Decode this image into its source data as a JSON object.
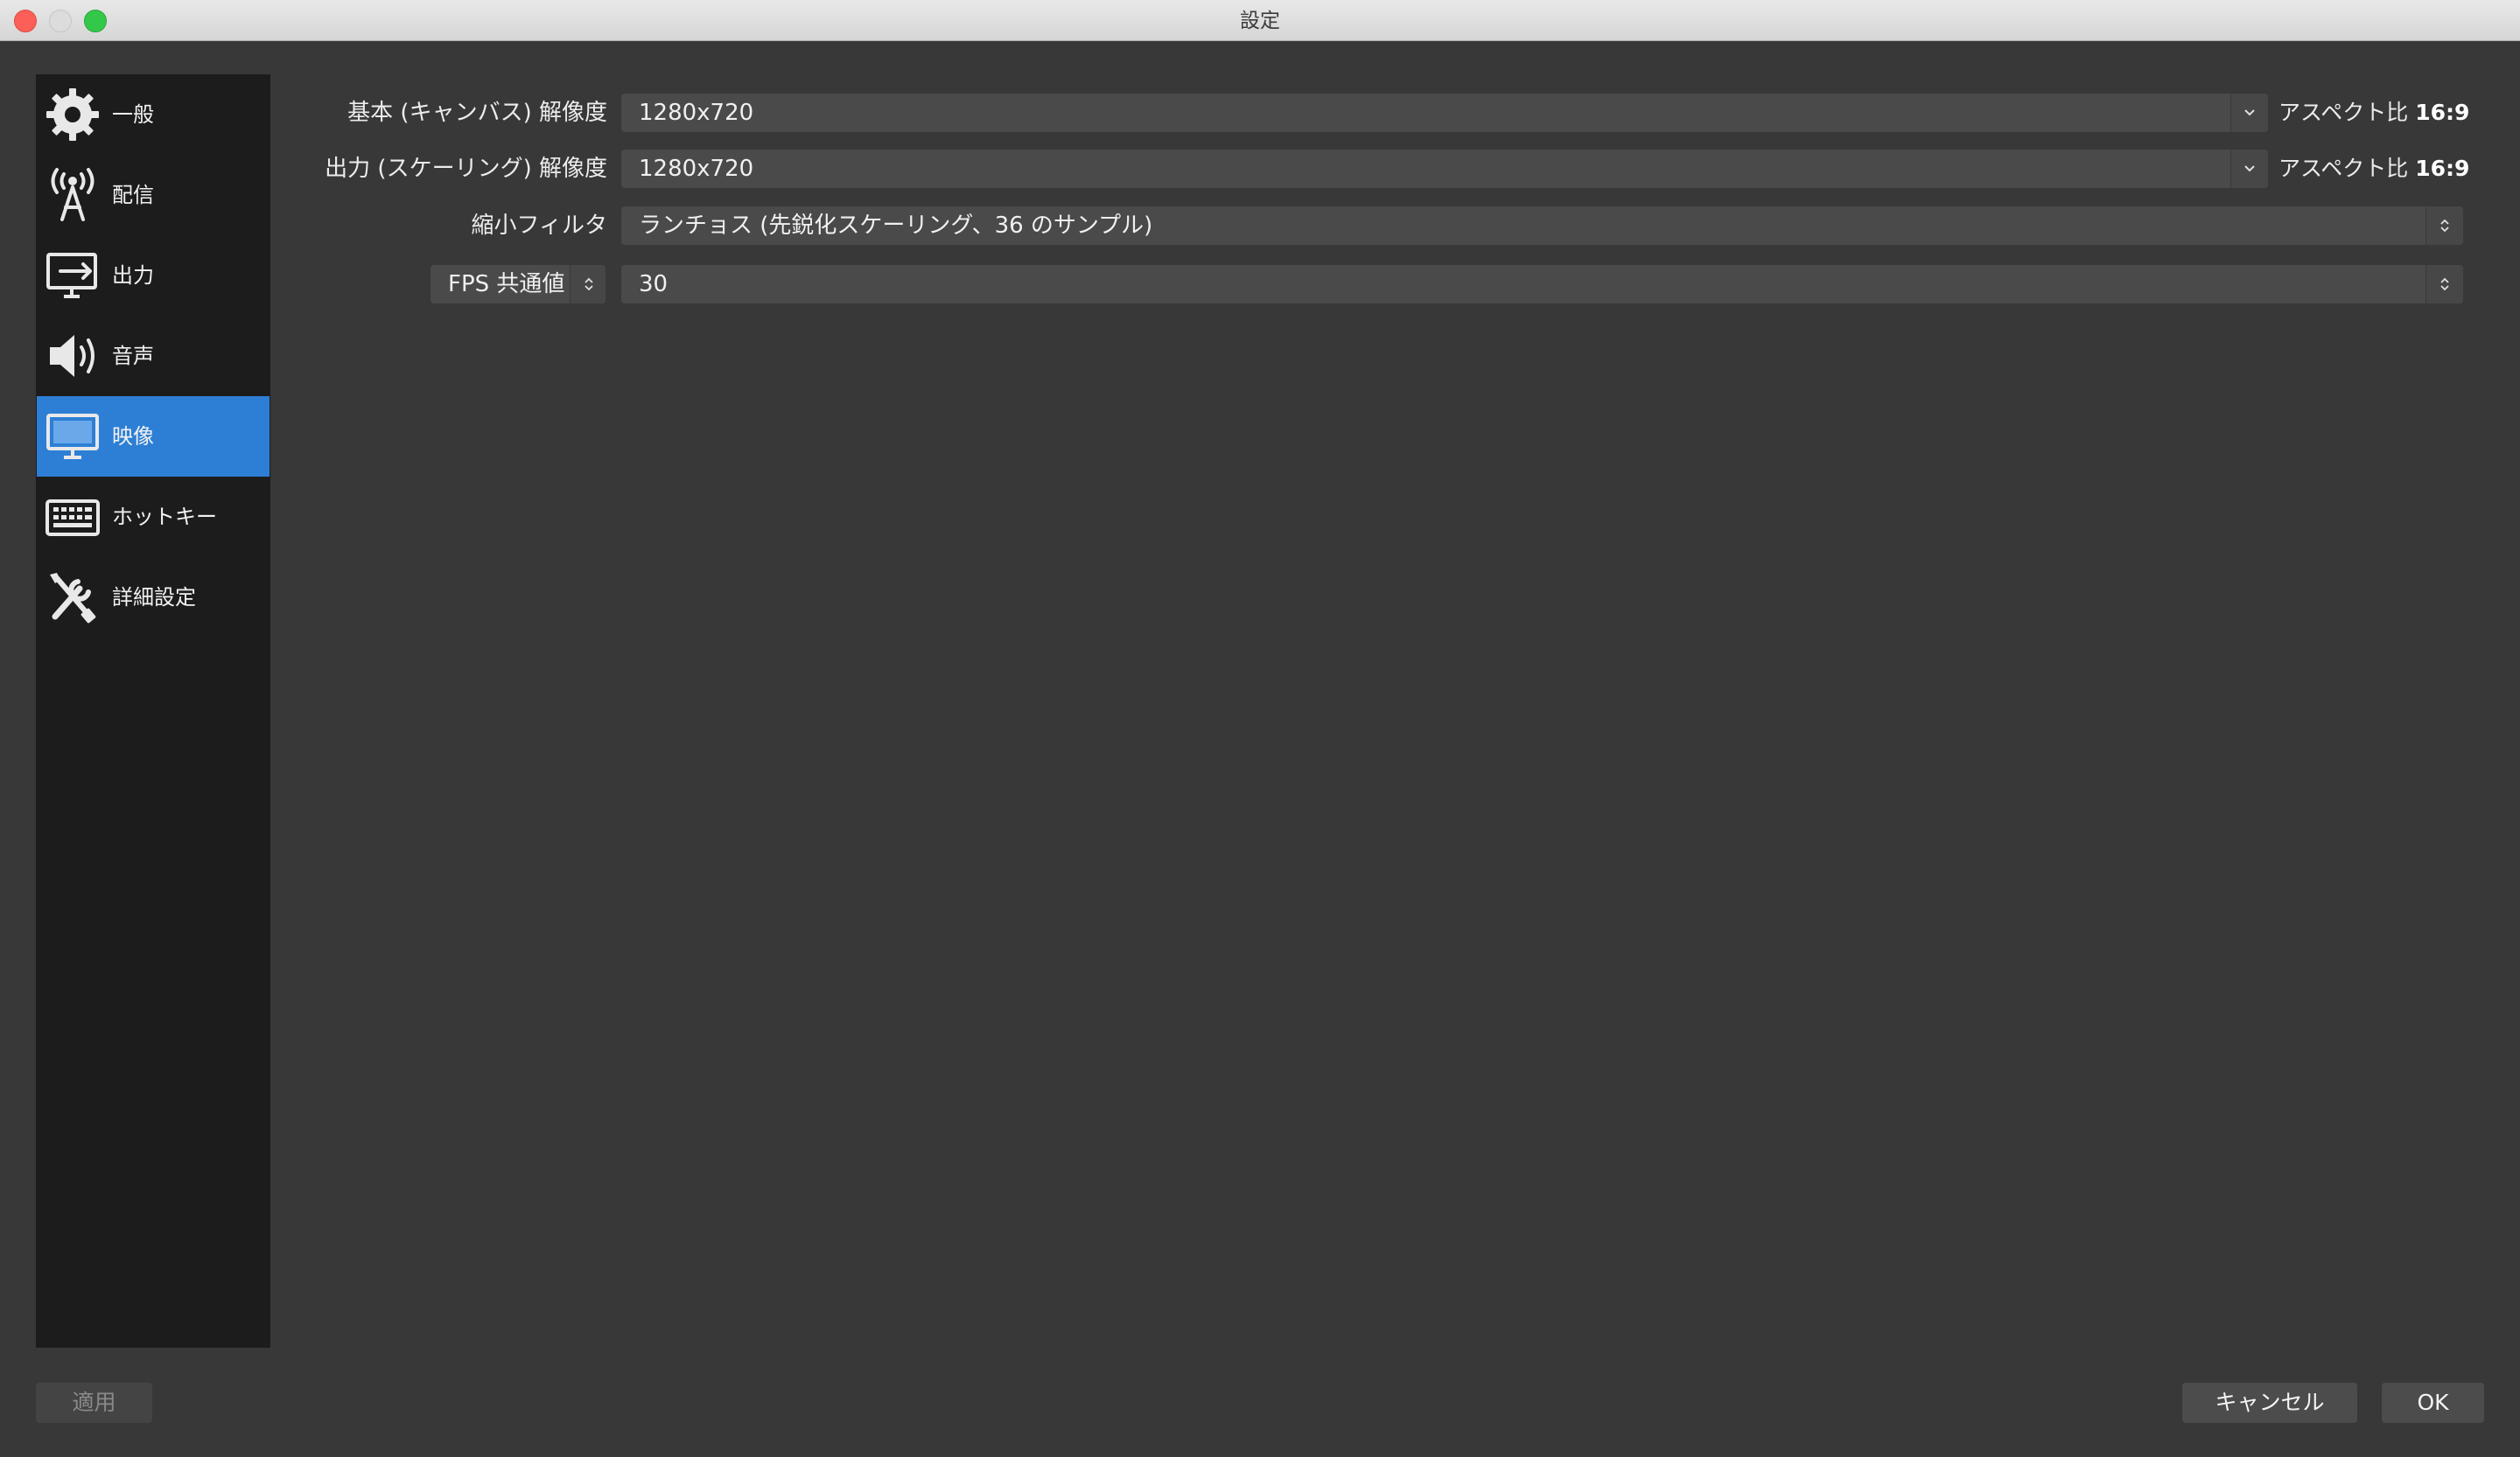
{
  "window": {
    "title": "設定"
  },
  "sidebar": {
    "items": [
      {
        "label": "一般",
        "icon": "gear-icon"
      },
      {
        "label": "配信",
        "icon": "broadcast-antenna-icon"
      },
      {
        "label": "出力",
        "icon": "output-monitor-icon"
      },
      {
        "label": "音声",
        "icon": "speaker-icon"
      },
      {
        "label": "映像",
        "icon": "monitor-icon",
        "active": true
      },
      {
        "label": "ホットキー",
        "icon": "keyboard-icon"
      },
      {
        "label": "詳細設定",
        "icon": "tools-icon"
      }
    ]
  },
  "video": {
    "base_resolution": {
      "label": "基本 (キャンバス) 解像度",
      "value": "1280x720",
      "aspect_prefix": "アスペクト比",
      "aspect_value": "16:9"
    },
    "output_resolution": {
      "label": "出力 (スケーリング) 解像度",
      "value": "1280x720",
      "aspect_prefix": "アスペクト比",
      "aspect_value": "16:9"
    },
    "downscale_filter": {
      "label": "縮小フィルタ",
      "value": "ランチョス (先鋭化スケーリング、36 のサンプル)"
    },
    "fps": {
      "type_label": "FPS 共通値",
      "value": "30"
    }
  },
  "buttons": {
    "apply": "適用",
    "cancel": "キャンセル",
    "ok": "OK"
  },
  "colors": {
    "accent": "#2d7fd6",
    "sidebar_bg": "#1c1c1c",
    "content_bg": "#383838"
  }
}
